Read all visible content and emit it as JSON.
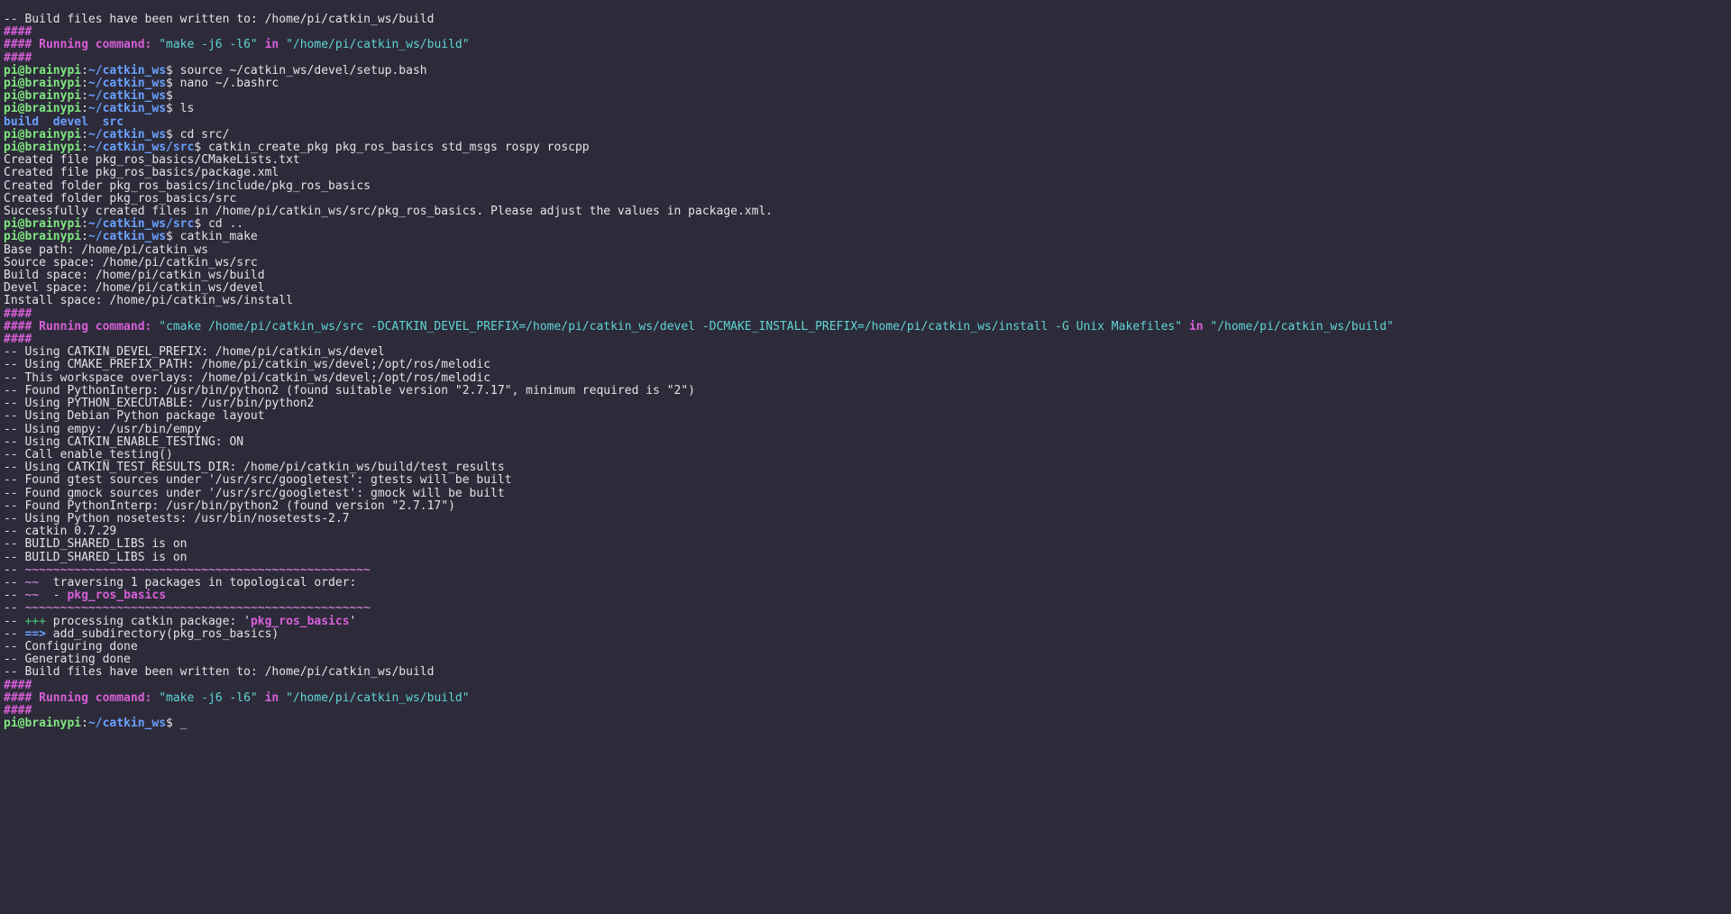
{
  "lines": [
    [
      {
        "cls": "c-default",
        "t": "-- Build files have been written to: /home/pi/catkin_ws/build"
      }
    ],
    [
      {
        "cls": "c-magenta bold",
        "t": "####"
      }
    ],
    [
      {
        "cls": "c-magenta bold",
        "t": "#### Running command: "
      },
      {
        "cls": "c-teal",
        "t": "\"make -j6 -l6\""
      },
      {
        "cls": "c-magenta bold",
        "t": " in "
      },
      {
        "cls": "c-teal",
        "t": "\"/home/pi/catkin_ws/build\""
      }
    ],
    [
      {
        "cls": "c-magenta bold",
        "t": "####"
      }
    ],
    [
      {
        "cls": "c-green-bold",
        "t": "pi@brainypi"
      },
      {
        "cls": "c-default",
        "t": ":"
      },
      {
        "cls": "c-blue",
        "t": "~/catkin_ws"
      },
      {
        "cls": "c-default",
        "t": "$ source ~/catkin_ws/devel/setup.bash"
      }
    ],
    [
      {
        "cls": "c-green-bold",
        "t": "pi@brainypi"
      },
      {
        "cls": "c-default",
        "t": ":"
      },
      {
        "cls": "c-blue",
        "t": "~/catkin_ws"
      },
      {
        "cls": "c-default",
        "t": "$ nano ~/.bashrc"
      }
    ],
    [
      {
        "cls": "c-green-bold",
        "t": "pi@brainypi"
      },
      {
        "cls": "c-default",
        "t": ":"
      },
      {
        "cls": "c-blue",
        "t": "~/catkin_ws"
      },
      {
        "cls": "c-default",
        "t": "$"
      }
    ],
    [
      {
        "cls": "c-green-bold",
        "t": "pi@brainypi"
      },
      {
        "cls": "c-default",
        "t": ":"
      },
      {
        "cls": "c-blue",
        "t": "~/catkin_ws"
      },
      {
        "cls": "c-default",
        "t": "$ ls"
      }
    ],
    [
      {
        "cls": "c-blue",
        "t": "build"
      },
      {
        "cls": "c-default",
        "t": "  "
      },
      {
        "cls": "c-blue",
        "t": "devel"
      },
      {
        "cls": "c-default",
        "t": "  "
      },
      {
        "cls": "c-blue",
        "t": "src"
      }
    ],
    [
      {
        "cls": "c-green-bold",
        "t": "pi@brainypi"
      },
      {
        "cls": "c-default",
        "t": ":"
      },
      {
        "cls": "c-blue",
        "t": "~/catkin_ws"
      },
      {
        "cls": "c-default",
        "t": "$ cd src/"
      }
    ],
    [
      {
        "cls": "c-green-bold",
        "t": "pi@brainypi"
      },
      {
        "cls": "c-default",
        "t": ":"
      },
      {
        "cls": "c-blue",
        "t": "~/catkin_ws/src"
      },
      {
        "cls": "c-default",
        "t": "$ catkin_create_pkg pkg_ros_basics std_msgs rospy roscpp"
      }
    ],
    [
      {
        "cls": "c-default",
        "t": "Created file pkg_ros_basics/CMakeLists.txt"
      }
    ],
    [
      {
        "cls": "c-default",
        "t": "Created file pkg_ros_basics/package.xml"
      }
    ],
    [
      {
        "cls": "c-default",
        "t": "Created folder pkg_ros_basics/include/pkg_ros_basics"
      }
    ],
    [
      {
        "cls": "c-default",
        "t": "Created folder pkg_ros_basics/src"
      }
    ],
    [
      {
        "cls": "c-default",
        "t": "Successfully created files in /home/pi/catkin_ws/src/pkg_ros_basics. Please adjust the values in package.xml."
      }
    ],
    [
      {
        "cls": "c-green-bold",
        "t": "pi@brainypi"
      },
      {
        "cls": "c-default",
        "t": ":"
      },
      {
        "cls": "c-blue",
        "t": "~/catkin_ws/src"
      },
      {
        "cls": "c-default",
        "t": "$ cd .."
      }
    ],
    [
      {
        "cls": "c-green-bold",
        "t": "pi@brainypi"
      },
      {
        "cls": "c-default",
        "t": ":"
      },
      {
        "cls": "c-blue",
        "t": "~/catkin_ws"
      },
      {
        "cls": "c-default",
        "t": "$ catkin_make"
      }
    ],
    [
      {
        "cls": "c-default",
        "t": "Base path: /home/pi/catkin_ws"
      }
    ],
    [
      {
        "cls": "c-default",
        "t": "Source space: /home/pi/catkin_ws/src"
      }
    ],
    [
      {
        "cls": "c-default",
        "t": "Build space: /home/pi/catkin_ws/build"
      }
    ],
    [
      {
        "cls": "c-default",
        "t": "Devel space: /home/pi/catkin_ws/devel"
      }
    ],
    [
      {
        "cls": "c-default",
        "t": "Install space: /home/pi/catkin_ws/install"
      }
    ],
    [
      {
        "cls": "c-magenta bold",
        "t": "####"
      }
    ],
    [
      {
        "cls": "c-magenta bold",
        "t": "#### Running command: "
      },
      {
        "cls": "c-teal",
        "t": "\"cmake /home/pi/catkin_ws/src -DCATKIN_DEVEL_PREFIX=/home/pi/catkin_ws/devel -DCMAKE_INSTALL_PREFIX=/home/pi/catkin_ws/install -G Unix Makefiles\""
      },
      {
        "cls": "c-magenta bold",
        "t": " in "
      },
      {
        "cls": "c-teal",
        "t": "\"/home/pi/catkin_ws/build\""
      }
    ],
    [
      {
        "cls": "c-magenta bold",
        "t": "####"
      }
    ],
    [
      {
        "cls": "c-default",
        "t": "-- Using CATKIN_DEVEL_PREFIX: /home/pi/catkin_ws/devel"
      }
    ],
    [
      {
        "cls": "c-default",
        "t": "-- Using CMAKE_PREFIX_PATH: /home/pi/catkin_ws/devel;/opt/ros/melodic"
      }
    ],
    [
      {
        "cls": "c-default",
        "t": "-- This workspace overlays: /home/pi/catkin_ws/devel;/opt/ros/melodic"
      }
    ],
    [
      {
        "cls": "c-default",
        "t": "-- Found PythonInterp: /usr/bin/python2 (found suitable version \"2.7.17\", minimum required is \"2\")"
      }
    ],
    [
      {
        "cls": "c-default",
        "t": "-- Using PYTHON_EXECUTABLE: /usr/bin/python2"
      }
    ],
    [
      {
        "cls": "c-default",
        "t": "-- Using Debian Python package layout"
      }
    ],
    [
      {
        "cls": "c-default",
        "t": "-- Using empy: /usr/bin/empy"
      }
    ],
    [
      {
        "cls": "c-default",
        "t": "-- Using CATKIN_ENABLE_TESTING: ON"
      }
    ],
    [
      {
        "cls": "c-default",
        "t": "-- Call enable_testing()"
      }
    ],
    [
      {
        "cls": "c-default",
        "t": "-- Using CATKIN_TEST_RESULTS_DIR: /home/pi/catkin_ws/build/test_results"
      }
    ],
    [
      {
        "cls": "c-default",
        "t": "-- Found gtest sources under '/usr/src/googletest': gtests will be built"
      }
    ],
    [
      {
        "cls": "c-default",
        "t": "-- Found gmock sources under '/usr/src/googletest': gmock will be built"
      }
    ],
    [
      {
        "cls": "c-default",
        "t": "-- Found PythonInterp: /usr/bin/python2 (found version \"2.7.17\")"
      }
    ],
    [
      {
        "cls": "c-default",
        "t": "-- Using Python nosetests: /usr/bin/nosetests-2.7"
      }
    ],
    [
      {
        "cls": "c-default",
        "t": "-- catkin 0.7.29"
      }
    ],
    [
      {
        "cls": "c-default",
        "t": "-- BUILD_SHARED_LIBS is on"
      }
    ],
    [
      {
        "cls": "c-default",
        "t": "-- BUILD_SHARED_LIBS is on"
      }
    ],
    [
      {
        "cls": "c-default",
        "t": "-- "
      },
      {
        "cls": "c-pink",
        "t": "~~~~~~~~~~~~~~~~~~~~~~~~~~~~~~~~~~~~~~~~~~~~~~~~~"
      }
    ],
    [
      {
        "cls": "c-default",
        "t": "-- "
      },
      {
        "cls": "c-pink",
        "t": "~~"
      },
      {
        "cls": "c-default",
        "t": "  traversing 1 packages in topological order:"
      }
    ],
    [
      {
        "cls": "c-default",
        "t": "-- "
      },
      {
        "cls": "c-pink",
        "t": "~~"
      },
      {
        "cls": "c-default",
        "t": "  - "
      },
      {
        "cls": "c-magenta bold",
        "t": "pkg_ros_basics"
      }
    ],
    [
      {
        "cls": "c-default",
        "t": "-- "
      },
      {
        "cls": "c-pink",
        "t": "~~~~~~~~~~~~~~~~~~~~~~~~~~~~~~~~~~~~~~~~~~~~~~~~~"
      }
    ],
    [
      {
        "cls": "c-default",
        "t": "-- "
      },
      {
        "cls": "c-green",
        "t": "+++"
      },
      {
        "cls": "c-default",
        "t": " processing catkin package: '"
      },
      {
        "cls": "c-magenta bold",
        "t": "pkg_ros_basics"
      },
      {
        "cls": "c-default",
        "t": "'"
      }
    ],
    [
      {
        "cls": "c-default",
        "t": "-- "
      },
      {
        "cls": "c-blue",
        "t": "==>"
      },
      {
        "cls": "c-default",
        "t": " add_subdirectory(pkg_ros_basics)"
      }
    ],
    [
      {
        "cls": "c-default",
        "t": "-- Configuring done"
      }
    ],
    [
      {
        "cls": "c-default",
        "t": "-- Generating done"
      }
    ],
    [
      {
        "cls": "c-default",
        "t": "-- Build files have been written to: /home/pi/catkin_ws/build"
      }
    ],
    [
      {
        "cls": "c-magenta bold",
        "t": "####"
      }
    ],
    [
      {
        "cls": "c-magenta bold",
        "t": "#### Running command: "
      },
      {
        "cls": "c-teal",
        "t": "\"make -j6 -l6\""
      },
      {
        "cls": "c-magenta bold",
        "t": " in "
      },
      {
        "cls": "c-teal",
        "t": "\"/home/pi/catkin_ws/build\""
      }
    ],
    [
      {
        "cls": "c-magenta bold",
        "t": "####"
      }
    ],
    [
      {
        "cls": "c-green-bold",
        "t": "pi@brainypi"
      },
      {
        "cls": "c-default",
        "t": ":"
      },
      {
        "cls": "c-blue",
        "t": "~/catkin_ws"
      },
      {
        "cls": "c-default",
        "t": "$ "
      },
      {
        "cls": "cursor",
        "t": "_"
      }
    ]
  ]
}
